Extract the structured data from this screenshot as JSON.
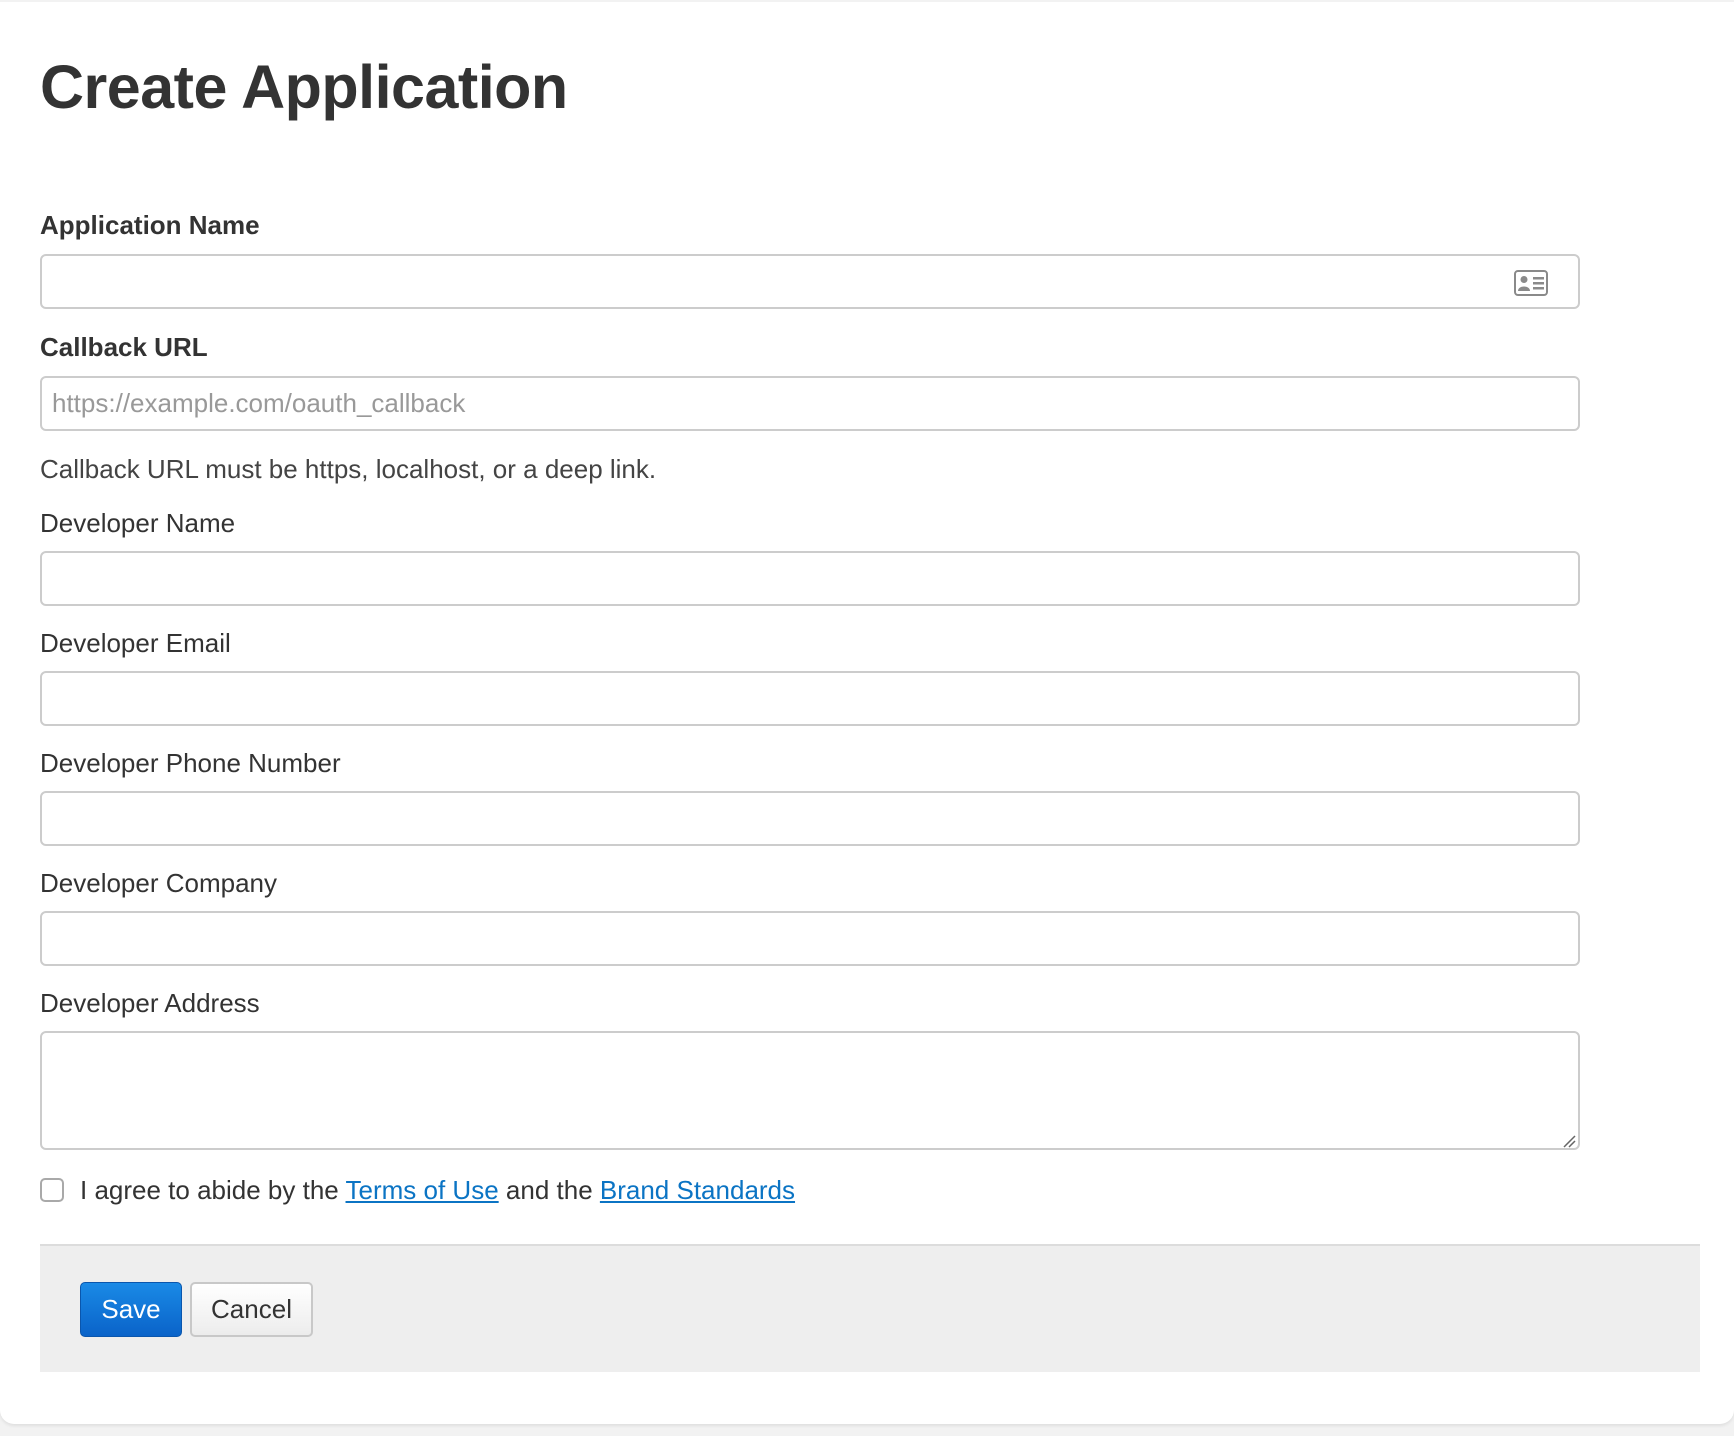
{
  "page": {
    "title": "Create Application"
  },
  "form": {
    "application_name": {
      "label": "Application Name",
      "value": "",
      "placeholder": ""
    },
    "callback_url": {
      "label": "Callback URL",
      "value": "",
      "placeholder": "https://example.com/oauth_callback",
      "help": "Callback URL must be https, localhost, or a deep link."
    },
    "developer_name": {
      "label": "Developer Name",
      "value": ""
    },
    "developer_email": {
      "label": "Developer Email",
      "value": ""
    },
    "developer_phone": {
      "label": "Developer Phone Number",
      "value": ""
    },
    "developer_company": {
      "label": "Developer Company",
      "value": ""
    },
    "developer_address": {
      "label": "Developer Address",
      "value": ""
    },
    "agreement": {
      "checked": false,
      "prefix": "I agree to abide by the",
      "terms_link": "Terms of Use",
      "middle": "and the",
      "brand_link": "Brand Standards"
    }
  },
  "actions": {
    "save_label": "Save",
    "cancel_label": "Cancel"
  },
  "colors": {
    "primary_button": "#0a63c9",
    "link": "#0b74c4",
    "footer_background": "#eeeeee"
  },
  "icons": {
    "autofill": "contact-card-icon",
    "resize": "resize-grip-icon"
  }
}
